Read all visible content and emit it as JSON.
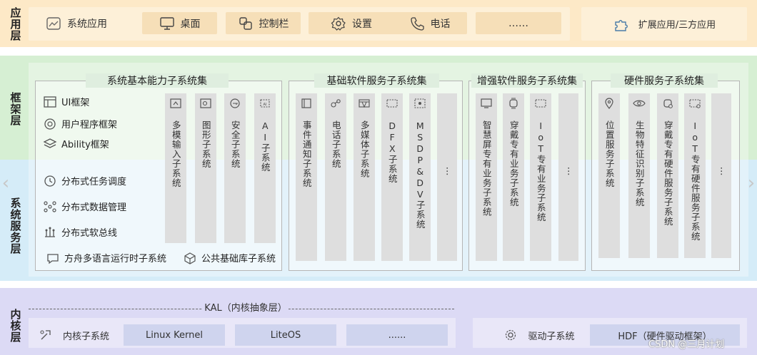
{
  "layers": {
    "app": "应用层",
    "framework": "框架层",
    "system_service": "系统服务层",
    "kernel": "内核层"
  },
  "app_layer": {
    "items": [
      "系统应用",
      "桌面",
      "控制栏",
      "设置",
      "电话",
      "……"
    ],
    "extension": "扩展应用/三方应用"
  },
  "framework_layer": {
    "items": [
      "UI框架",
      "用户程序框架",
      "Ability框架"
    ]
  },
  "system_layer": {
    "items": [
      "分布式任务调度",
      "分布式数据管理",
      "分布式软总线"
    ],
    "bottom_items": [
      "方舟多语言运行时子系统",
      "公共基础库子系统"
    ]
  },
  "groups": [
    {
      "title": "系统基本能力子系统集",
      "columns": [
        "多模输入子系统",
        "图形子系统",
        "安全子系统",
        "AI子系统"
      ]
    },
    {
      "title": "基础软件服务子系统集",
      "columns": [
        "事件通知子系统",
        "电话子系统",
        "多媒体子系统",
        "DFX子系统",
        "MSDP&DV子系统",
        "⋮"
      ]
    },
    {
      "title": "增强软件服务子系统集",
      "columns": [
        "智慧屏专有业务子系统",
        "穿戴专有业务子系统",
        "IoT专有业务子系统",
        "⋮"
      ]
    },
    {
      "title": "硬件服务子系统集",
      "columns": [
        "位置服务子系统",
        "生物特征识别子系统",
        "穿戴专有硬件服务子系统",
        "IoT专有硬件服务子系统",
        "⋮"
      ]
    }
  ],
  "kernel_layer": {
    "kal": "KAL（内核抽象层）",
    "items": [
      "内核子系统",
      "Linux Kernel",
      "LiteOS",
      "......"
    ],
    "driver": "驱动子系统",
    "hdf": "HDF（硬件驱动框架）"
  },
  "watermark": "CSDN @三月计划",
  "colors": {
    "app_band": "#fde9c7",
    "framework_band": "#d6efd3",
    "system_band": "#d5ecf8",
    "kernel_band": "#dcdaf5",
    "column_fill": "#dedede"
  }
}
